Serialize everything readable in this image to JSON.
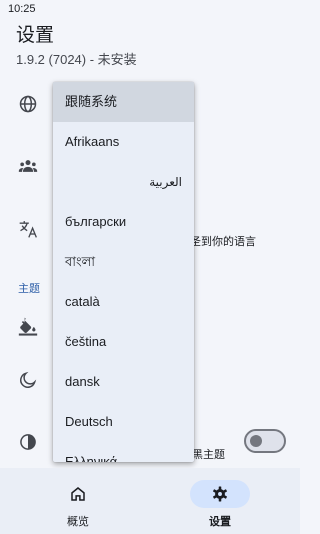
{
  "status_bar": {
    "time": "10:25"
  },
  "header": {
    "title": "设置",
    "subtitle": "1.9.2 (7024) - 未安装"
  },
  "settings": {
    "section_theme": "主题",
    "language_hint_peek": "圣到你的语言",
    "dark_theme_peek": "黑主题",
    "icons": [
      "globe-icon",
      "people-icon",
      "translate-icon",
      "paint-bucket-icon",
      "moon-icon",
      "contrast-icon"
    ],
    "dark_theme_enabled": false
  },
  "language_menu": {
    "items": [
      {
        "label": "跟随系统",
        "selected": true
      },
      {
        "label": "Afrikaans"
      },
      {
        "label": "العربية",
        "rtl": true
      },
      {
        "label": "български"
      },
      {
        "label": "বাংলা"
      },
      {
        "label": "català"
      },
      {
        "label": "čeština"
      },
      {
        "label": "dansk"
      },
      {
        "label": "Deutsch"
      },
      {
        "label": "Ελληνικά"
      }
    ]
  },
  "bottom_nav": {
    "overview_label": "概览",
    "settings_label": "设置",
    "active": "settings"
  },
  "colors": {
    "accent": "#2e5fa8",
    "nav_active_pill": "#d3e3fd",
    "menu_background": "#e9eef7",
    "menu_selected": "#d1d7e0"
  }
}
